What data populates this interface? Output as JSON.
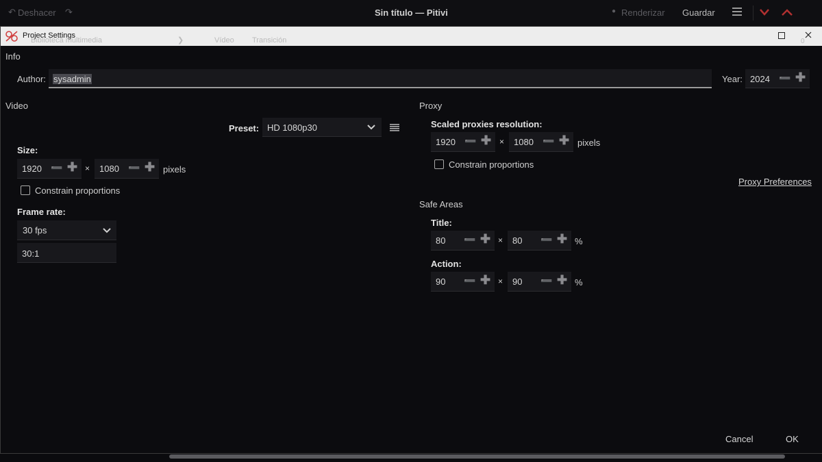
{
  "app": {
    "undo_label": "Deshacer",
    "window_title": "Sin título — Pitivi",
    "render_label": "Renderizar",
    "save_label": "Guardar",
    "behind_tabs": [
      "Biblioteca multimedia",
      "Vídeo",
      "Transición"
    ],
    "behind_counter": "0"
  },
  "dialog": {
    "title": "Project Settings",
    "info_section": "Info",
    "author_label": "Author:",
    "author_value": "sysadmin",
    "year_label": "Year:",
    "year_value": "2024",
    "video_section": "Video",
    "preset_label": "Preset:",
    "preset_value": "HD 1080p30",
    "size_label": "Size:",
    "size_width": "1920",
    "size_height": "1080",
    "times": "×",
    "pixels": "pixels",
    "constrain_label": "Constrain proportions",
    "constrain_checked": false,
    "framerate_label": "Frame rate:",
    "framerate_value": "30 fps",
    "framerate_ratio": "30:1",
    "proxy_section": "Proxy",
    "scaled_label": "Scaled proxies resolution:",
    "proxy_width": "1920",
    "proxy_height": "1080",
    "proxy_constrain_label": "Constrain proportions",
    "proxy_constrain_checked": false,
    "proxy_prefs_link": "Proxy Preferences",
    "safe_section": "Safe Areas",
    "title_label": "Title:",
    "title_w": "80",
    "title_h": "80",
    "action_label": "Action:",
    "action_w": "90",
    "action_h": "90",
    "percent": "%",
    "cancel_label": "Cancel",
    "ok_label": "OK"
  },
  "colors": {
    "background": "#0b0b0e",
    "titlebar": "#ededed",
    "field": "#18181c",
    "accent_red": "#c0392b"
  }
}
